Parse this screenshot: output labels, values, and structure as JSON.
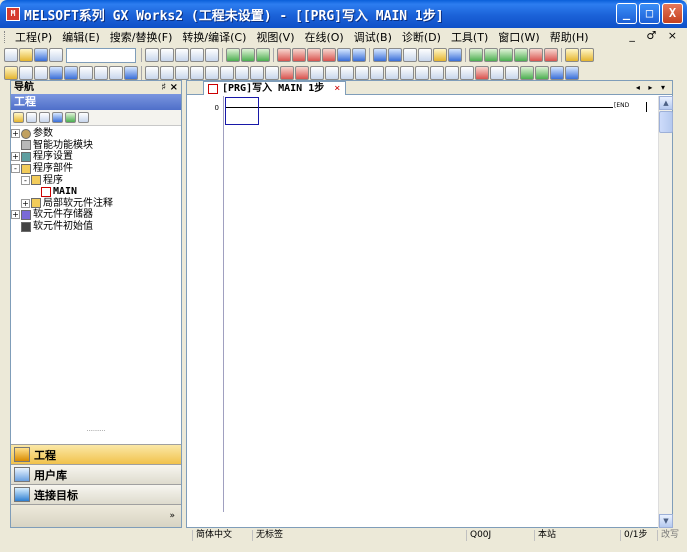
{
  "window": {
    "app_icon_label": "M",
    "title": "MELSOFT系列 GX Works2 (工程未设置) - [[PRG]写入 MAIN 1步]",
    "minimize_label": "_",
    "maximize_label": "□",
    "close_label": "X"
  },
  "menubar": {
    "items": [
      {
        "label": "工程(P)"
      },
      {
        "label": "编辑(E)"
      },
      {
        "label": "搜索/替换(F)"
      },
      {
        "label": "转换/编译(C)"
      },
      {
        "label": "视图(V)"
      },
      {
        "label": "在线(O)"
      },
      {
        "label": "调试(B)"
      },
      {
        "label": "诊断(D)"
      },
      {
        "label": "工具(T)"
      },
      {
        "label": "窗口(W)"
      },
      {
        "label": "帮助(H)"
      }
    ],
    "mdi_controls": "_ ♂ ×"
  },
  "nav": {
    "header": "导航",
    "header_controls": "♯ ×",
    "section": "工程",
    "tree": [
      {
        "label": "参数",
        "icon": "gear-icon",
        "expand": "+"
      },
      {
        "label": "智能功能模块",
        "icon": "module-icon",
        "expand": ""
      },
      {
        "label": "程序设置",
        "icon": "setting-icon",
        "expand": "+"
      },
      {
        "label": "程序部件",
        "icon": "folder-icon",
        "expand": "-"
      },
      {
        "label": "程序",
        "icon": "folder-icon",
        "expand": "-"
      },
      {
        "label": "MAIN",
        "icon": "page-icon",
        "expand": ""
      },
      {
        "label": "局部软元件注释",
        "icon": "folder-icon",
        "expand": "+"
      },
      {
        "label": "软元件存储器",
        "icon": "database-icon",
        "expand": "+"
      },
      {
        "label": "软元件初始值",
        "icon": "init-icon",
        "expand": ""
      }
    ],
    "bottom_buttons": [
      {
        "label": "工程"
      },
      {
        "label": "用户库"
      },
      {
        "label": "连接目标"
      }
    ],
    "overflow": "»"
  },
  "editor": {
    "tab_label": "[PRG]写入 MAIN 1步",
    "tab_close": "×",
    "tab_nav": "◂ ▸ ▾",
    "step_number": "0",
    "end_label": "[END"
  },
  "statusbar": {
    "language": "简体中文",
    "title": "无标签",
    "cpu": "Q00J",
    "station": "本站",
    "steps": "0/1步",
    "mode": "改写"
  }
}
